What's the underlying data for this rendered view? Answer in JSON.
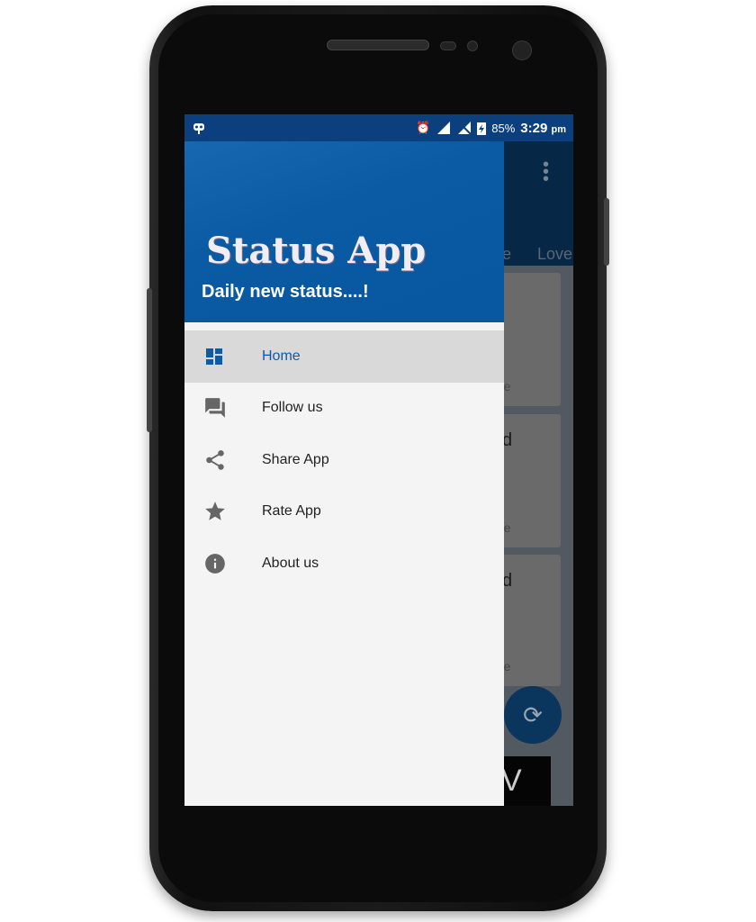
{
  "status_bar": {
    "battery": "85%",
    "time": "3:29",
    "ampm": "pm"
  },
  "background": {
    "tabs": [
      "e",
      "Love"
    ],
    "cards": [
      {
        "title": "",
        "action": "re"
      },
      {
        "title": "d",
        "action": "re"
      },
      {
        "title": "d",
        "action": "re"
      }
    ],
    "banner": "V"
  },
  "drawer": {
    "title": "Status App",
    "subtitle": "Daily new status....!",
    "items": [
      {
        "label": "Home",
        "icon": "dashboard-icon",
        "active": true
      },
      {
        "label": "Follow us",
        "icon": "forum-icon"
      },
      {
        "label": "Share App",
        "icon": "share-icon"
      },
      {
        "label": "Rate App",
        "icon": "star-icon"
      },
      {
        "label": "About us",
        "icon": "info-icon"
      }
    ]
  },
  "colors": {
    "primary": "#0758a0",
    "active_text": "#0b5ca8",
    "icon_gray": "#666666"
  }
}
